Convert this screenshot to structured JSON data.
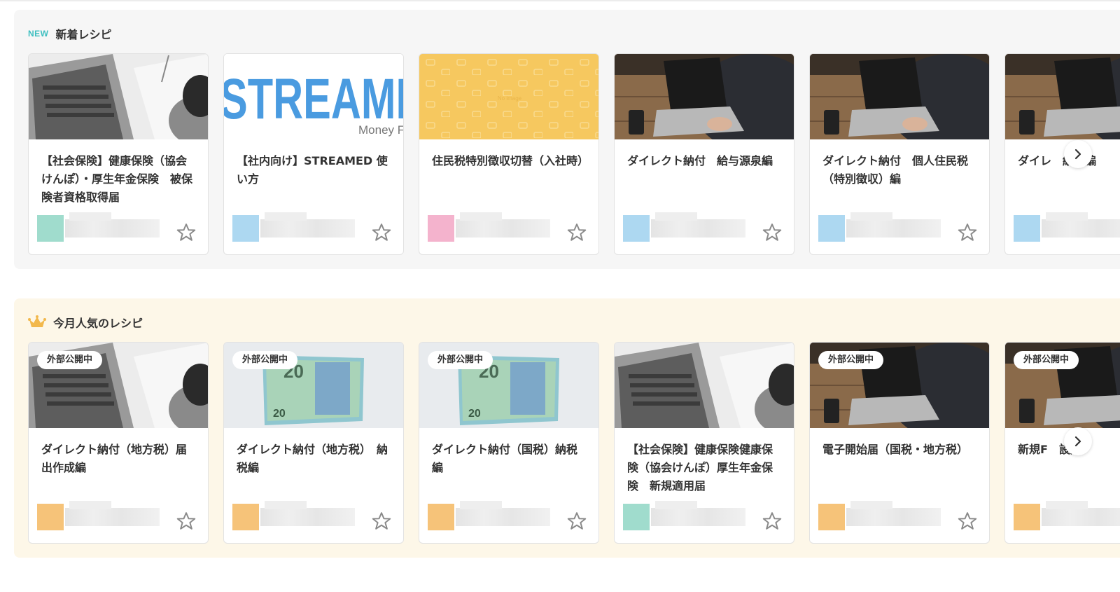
{
  "sections": {
    "new": {
      "tag": "NEW",
      "title": "新着レシピ",
      "cards": [
        {
          "title": "【社会保険】健康保険（協会けんぽ）・厚生年金保険　被保険者資格取得届",
          "thumb": "laptop-writing",
          "author_color": "#8fd6c4"
        },
        {
          "title": "【社内向け】STREAMED 使い方",
          "thumb": "streamed-logo",
          "author_color": "#9fd1ee",
          "logo_text": "STREAMI",
          "logo_sub": "Money F"
        },
        {
          "title": "住民税特別徴収切替（入社時）",
          "thumb": "no-image",
          "author_color": "#f2a6c4",
          "noimage_text": "No image"
        },
        {
          "title": "ダイレクト納付　給与源泉編",
          "thumb": "desk-laptop",
          "author_color": "#9fd1ee"
        },
        {
          "title": "ダイレクト納付　個人住民税（特別徴収）編",
          "thumb": "desk-laptop",
          "author_color": "#9fd1ee"
        },
        {
          "title": "ダイレ　納付編",
          "thumb": "desk-laptop",
          "author_color": "#9fd1ee"
        }
      ]
    },
    "popular": {
      "title": "今月人気のレシピ",
      "cards": [
        {
          "title": "ダイレクト納付（地方税）届出作成編",
          "thumb": "laptop-writing",
          "badge": "外部公開中",
          "author_color": "#f5b862"
        },
        {
          "title": "ダイレクト納付（地方税）　納税編",
          "thumb": "euro-note",
          "badge": "外部公開中",
          "author_color": "#f5b862"
        },
        {
          "title": "ダイレクト納付（国税）納税編",
          "thumb": "euro-note",
          "badge": "外部公開中",
          "author_color": "#f5b862"
        },
        {
          "title": "【社会保険】健康保険健康保険（協会けんぽ）厚生年金保険　新規適用届",
          "thumb": "laptop-writing",
          "author_color": "#8fd6c4"
        },
        {
          "title": "電子開始届（国税・地方税）",
          "thumb": "desk-laptop",
          "badge": "外部公開中",
          "author_color": "#f5b862"
        },
        {
          "title": "新規F　設定",
          "thumb": "desk-laptop",
          "badge": "外部公開中",
          "author_color": "#f5b862"
        }
      ]
    }
  },
  "icons": {
    "star": "star-outline-icon",
    "next": "chevron-right-icon",
    "crown": "crown-icon"
  },
  "colors": {
    "new_tag": "#3dbfc0",
    "new_bg": "#f6f6f6",
    "popular_bg": "#fdf7e8",
    "crown": "#f2b84b"
  }
}
